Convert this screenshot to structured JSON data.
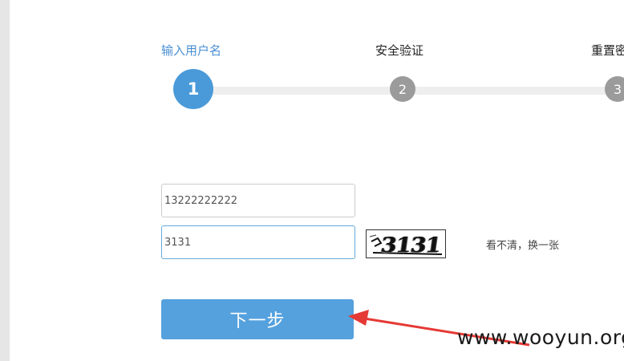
{
  "steps": [
    {
      "number": "1",
      "label": "输入用户名",
      "state": "active"
    },
    {
      "number": "2",
      "label": "安全验证",
      "state": "inactive"
    },
    {
      "number": "3",
      "label": "重置密",
      "state": "inactive"
    }
  ],
  "form": {
    "phone_value": "13222222222",
    "captcha_value": "3131",
    "captcha_image_text": "3131",
    "refresh_label": "看不清，换一张",
    "next_label": "下一步"
  },
  "watermark": "www.wooyun.org",
  "colors": {
    "accent": "#4a9ad9",
    "button": "#55a1de",
    "inactive_step": "#9b9b9b",
    "arrow": "#e53935"
  }
}
